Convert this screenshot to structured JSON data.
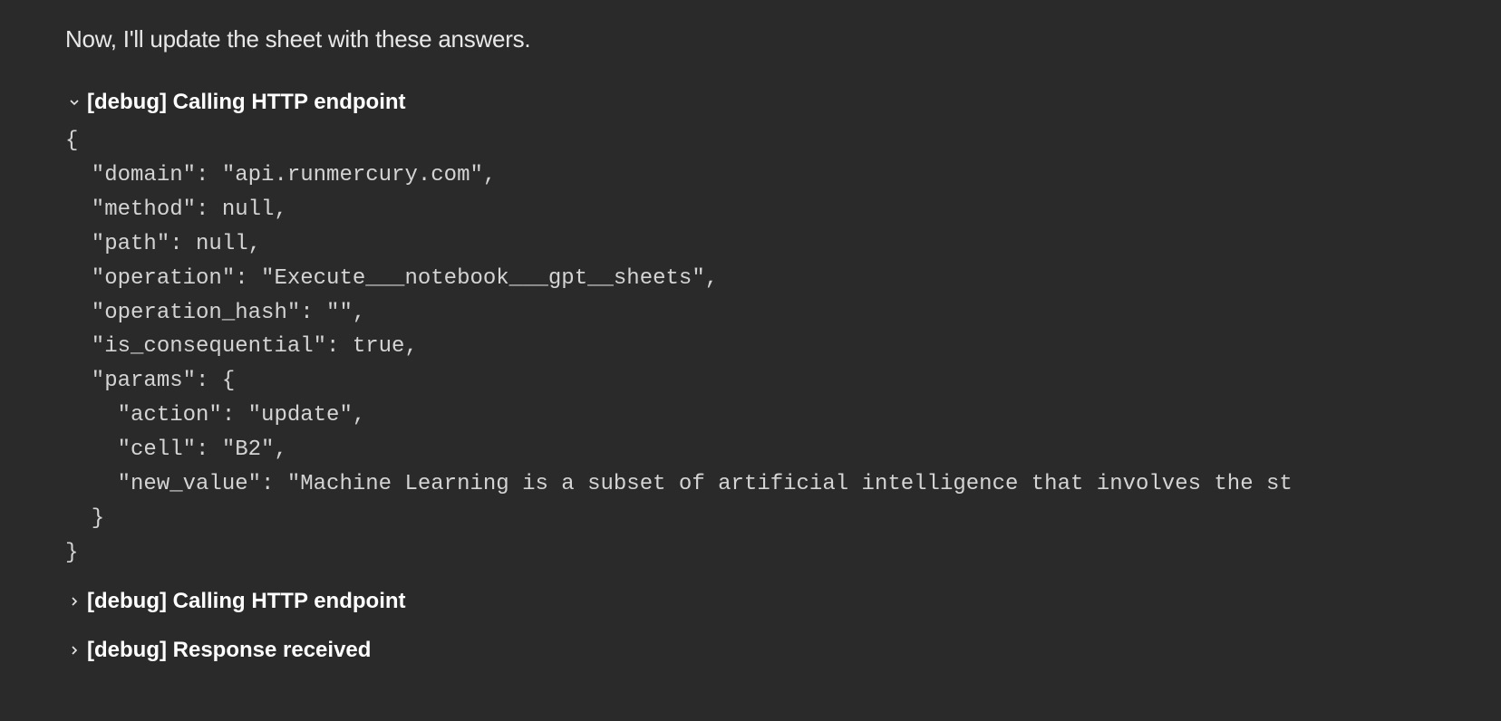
{
  "intro_text": "Now, I'll update the sheet with these answers.",
  "debug_items": [
    {
      "label": "[debug] Calling HTTP endpoint",
      "expanded": true,
      "code": "{\n  \"domain\": \"api.runmercury.com\",\n  \"method\": null,\n  \"path\": null,\n  \"operation\": \"Execute___notebook___gpt__sheets\",\n  \"operation_hash\": \"\",\n  \"is_consequential\": true,\n  \"params\": {\n    \"action\": \"update\",\n    \"cell\": \"B2\",\n    \"new_value\": \"Machine Learning is a subset of artificial intelligence that involves the st\n  }\n}"
    },
    {
      "label": "[debug] Calling HTTP endpoint",
      "expanded": false
    },
    {
      "label": "[debug] Response received",
      "expanded": false
    }
  ]
}
